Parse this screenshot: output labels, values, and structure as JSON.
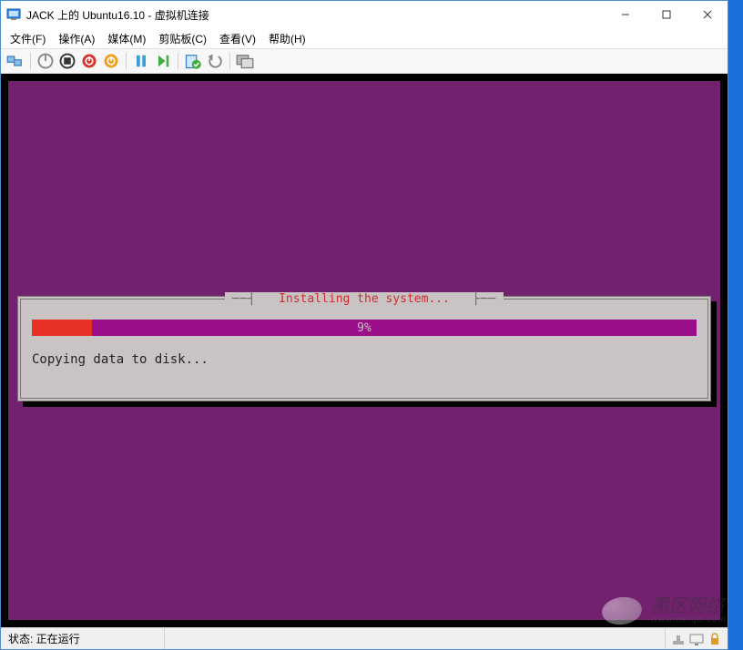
{
  "window": {
    "title": "JACK 上的 Ubuntu16.10 - 虚拟机连接"
  },
  "menu": {
    "file": "文件(F)",
    "action": "操作(A)",
    "media": "媒体(M)",
    "clipboard": "剪贴板(C)",
    "view": "查看(V)",
    "help": "帮助(H)"
  },
  "installer": {
    "title": "Installing the system...",
    "percent_label": "9%",
    "percent_value": 9,
    "message": "Copying data to disk..."
  },
  "status": {
    "label": "状态: 正在运行"
  },
  "watermark": {
    "line1": "黑区网络",
    "line2": "www.heiqu.com"
  }
}
